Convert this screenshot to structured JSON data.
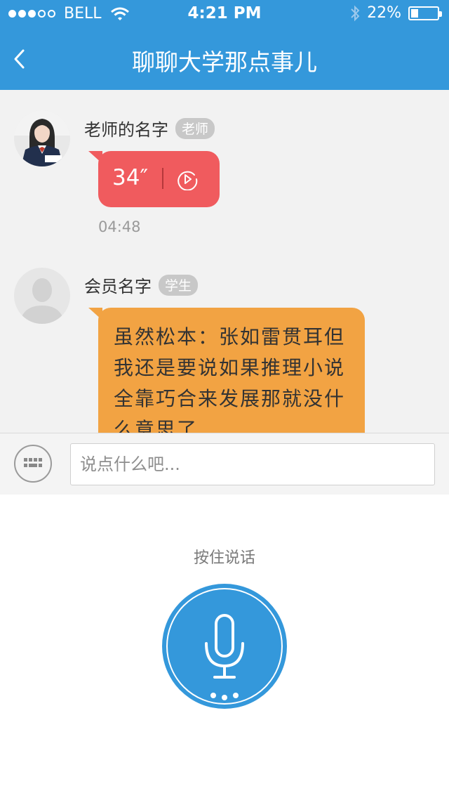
{
  "status": {
    "carrier": "BELL",
    "time": "4:21 PM",
    "battery": "22%",
    "battery_level": 0.22
  },
  "nav": {
    "title": "聊聊大学那点事儿"
  },
  "messages": [
    {
      "sender": "老师的名字",
      "role": "老师",
      "duration": "34″",
      "time": "04:48"
    },
    {
      "sender": "会员名字",
      "role": "学生",
      "text": "虽然松本：张如雷贯耳但我还是要说如果推理小说全靠巧合来发展那就没什么意思了"
    }
  ],
  "input": {
    "placeholder": "说点什么吧..."
  },
  "voice_panel": {
    "hold_label": "按住说话"
  },
  "colors": {
    "header": "#3498db",
    "voice_bubble": "#f05b5e",
    "text_bubble": "#f2a343",
    "badge": "#c8c8c8",
    "mic": "#3498db"
  }
}
